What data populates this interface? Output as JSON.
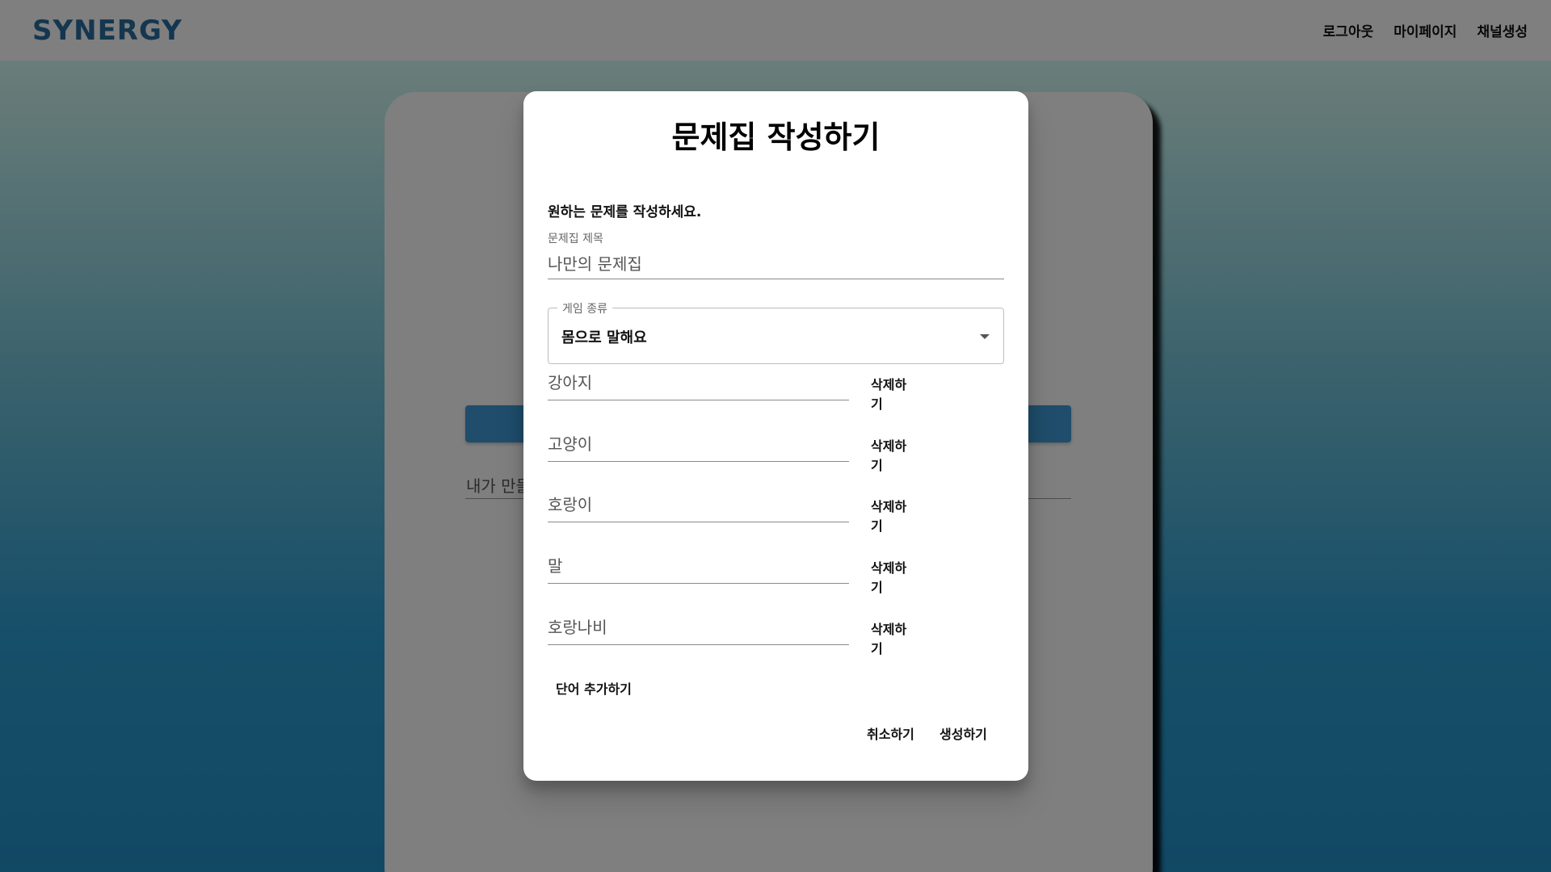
{
  "header": {
    "logo": "SYNERGY",
    "nav": [
      "로그아웃",
      "마이페이지",
      "채널생성"
    ]
  },
  "background_page": {
    "field_text": "내가 만들"
  },
  "modal": {
    "title": "문제집 작성하기",
    "description": "원하는 문제를 작성하세요.",
    "title_field": {
      "label": "문제집 제목",
      "value": "나만의 문제집"
    },
    "game_type": {
      "label": "게임 종류",
      "value": "몸으로 말해요"
    },
    "words": [
      "강아지",
      "고양이",
      "호랑이",
      "말",
      "호랑나비"
    ],
    "delete_label": "삭제하기",
    "add_word_label": "단어 추가하기",
    "cancel_label": "취소하기",
    "create_label": "생성하기"
  },
  "colors": {
    "brand": "#2b6d9f",
    "backdrop": "rgba(0,0,0,0.5)"
  },
  "icons": {
    "select_arrow": "caret-down-icon"
  }
}
